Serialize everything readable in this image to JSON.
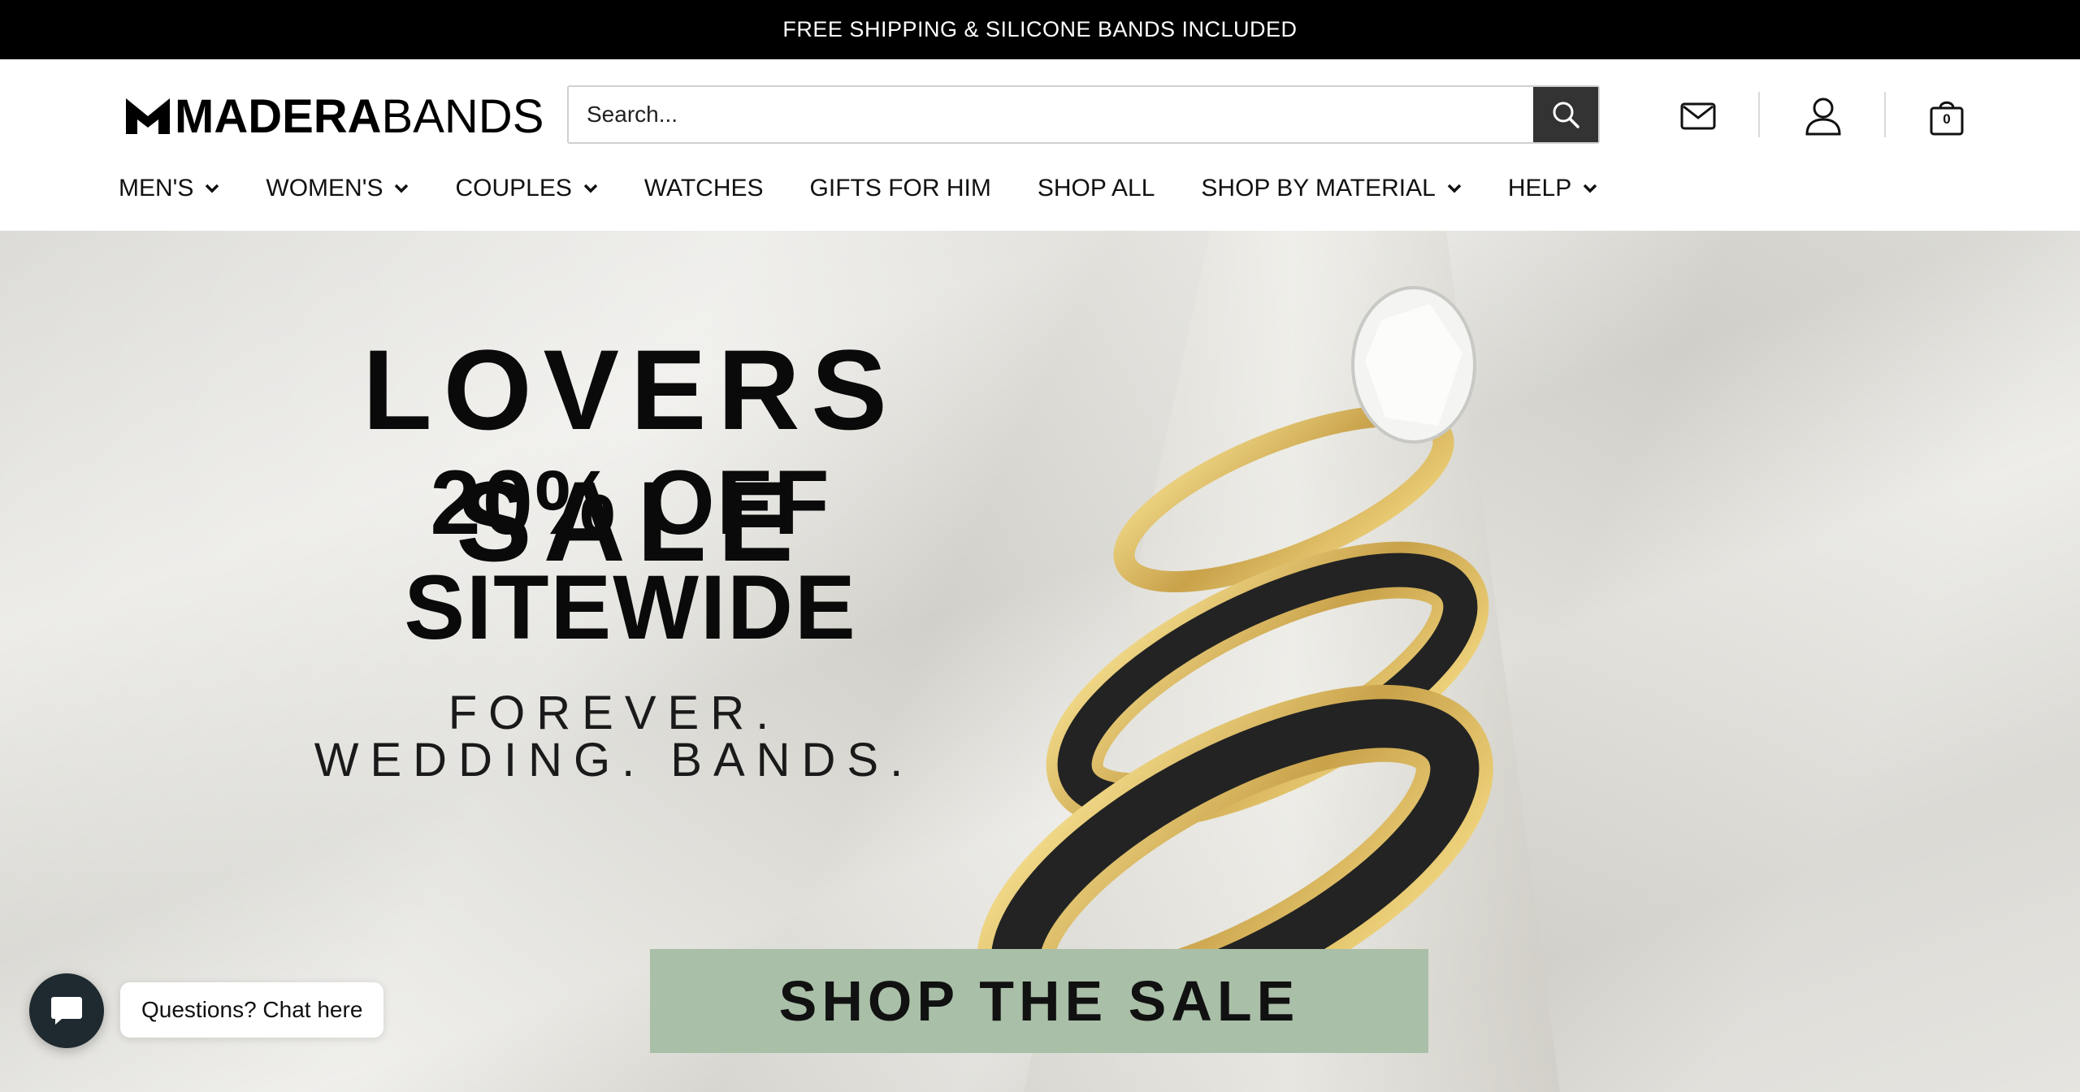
{
  "announcement": {
    "text": "FREE SHIPPING & SILICONE BANDS INCLUDED"
  },
  "header": {
    "logo": {
      "bold": "MADERA",
      "regular": "BANDS"
    },
    "search": {
      "placeholder": "Search..."
    },
    "icons": {
      "mail": "mail-icon",
      "account": "account-icon",
      "cart": "cart-icon"
    },
    "cart_count": "0"
  },
  "nav": {
    "items": [
      {
        "label": "MEN'S",
        "dropdown": true
      },
      {
        "label": "WOMEN'S",
        "dropdown": true
      },
      {
        "label": "COUPLES",
        "dropdown": true
      },
      {
        "label": "WATCHES",
        "dropdown": false
      },
      {
        "label": "GIFTS FOR HIM",
        "dropdown": false
      },
      {
        "label": "SHOP ALL",
        "dropdown": false
      },
      {
        "label": "SHOP BY MATERIAL",
        "dropdown": true
      },
      {
        "label": "HELP",
        "dropdown": true
      }
    ]
  },
  "hero": {
    "headline": "LOVERS SALE",
    "subheadline": "20% OFF SITEWIDE",
    "tagline_line1": "FOREVER.",
    "tagline_line2": "WEDDING. BANDS.",
    "cta_label": "SHOP THE SALE"
  },
  "chat": {
    "label": "Questions? Chat here"
  },
  "colors": {
    "announcement_bg": "#000000",
    "search_button_bg": "#333333",
    "cta_bg": "#a9bfa8",
    "chat_button_bg": "#1f2a30"
  }
}
